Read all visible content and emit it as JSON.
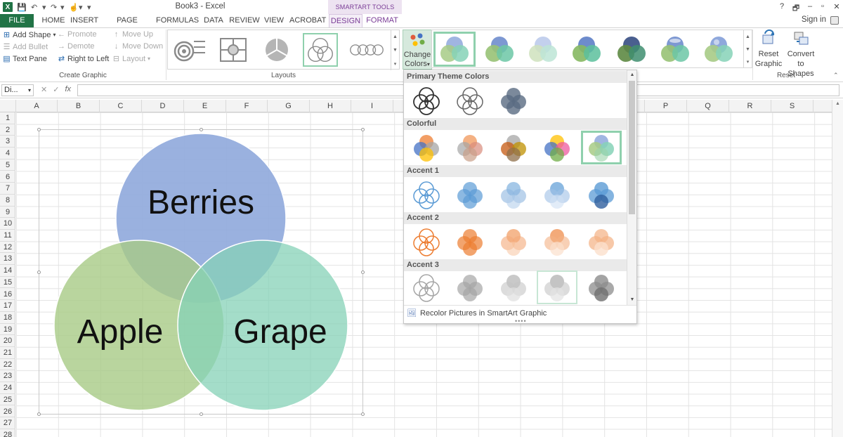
{
  "titlebar": {
    "title": "Book3 - Excel",
    "contextual": "SMARTART TOOLS",
    "help": "?",
    "restore": "🗗",
    "minimize": "–",
    "maximize": "▫",
    "close": "✕"
  },
  "tabs": {
    "file": "FILE",
    "home": "HOME",
    "insert": "INSERT",
    "page_layout": "PAGE LAYOUT",
    "formulas": "FORMULAS",
    "data": "DATA",
    "review": "REVIEW",
    "view": "VIEW",
    "acrobat": "ACROBAT",
    "design": "DESIGN",
    "format": "FORMAT",
    "sign_in": "Sign in"
  },
  "ribbon": {
    "create_graphic": {
      "add_shape": "Add Shape",
      "add_bullet": "Add Bullet",
      "text_pane": "Text Pane",
      "promote": "Promote",
      "demote": "Demote",
      "right_to_left": "Right to Left",
      "move_up": "Move Up",
      "move_down": "Move Down",
      "layout": "Layout",
      "group_label": "Create Graphic"
    },
    "layouts": {
      "group_label": "Layouts"
    },
    "change_colors": {
      "line1": "Change",
      "line2": "Colors"
    },
    "reset": {
      "reset_line1": "Reset",
      "reset_line2": "Graphic",
      "convert_line1": "Convert",
      "convert_line2": "to Shapes",
      "group_label": "Reset"
    }
  },
  "formula_bar": {
    "name_box": "Di...",
    "fx": "fx"
  },
  "columns": [
    "A",
    "B",
    "C",
    "D",
    "E",
    "F",
    "G",
    "H",
    "I",
    "",
    "",
    "",
    "",
    "",
    "",
    "P",
    "Q",
    "R",
    "S"
  ],
  "rows": [
    "1",
    "2",
    "3",
    "4",
    "5",
    "6",
    "7",
    "8",
    "9",
    "10",
    "11",
    "12",
    "13",
    "14",
    "15",
    "16",
    "17",
    "18",
    "19",
    "20",
    "21",
    "22",
    "23",
    "24",
    "25",
    "26",
    "27",
    "28"
  ],
  "venn": {
    "top_label": "Berries",
    "left_label": "Apple",
    "right_label": "Grape",
    "colors": {
      "top": "#8fa8dc",
      "left": "#a7cb86",
      "right": "#86d2b7"
    }
  },
  "dropdown": {
    "sections": [
      {
        "title": "Primary Theme Colors"
      },
      {
        "title": "Colorful"
      },
      {
        "title": "Accent 1"
      },
      {
        "title": "Accent 2"
      },
      {
        "title": "Accent 3"
      }
    ],
    "recolor": "Recolor Pictures in SmartArt Graphic",
    "selected": "Colorful option 5",
    "accent_colors": {
      "accent1": "#5b9bd5",
      "accent2": "#ed7d31",
      "accent3": "#a5a5a5",
      "highlight": "#8fd0ad"
    }
  }
}
